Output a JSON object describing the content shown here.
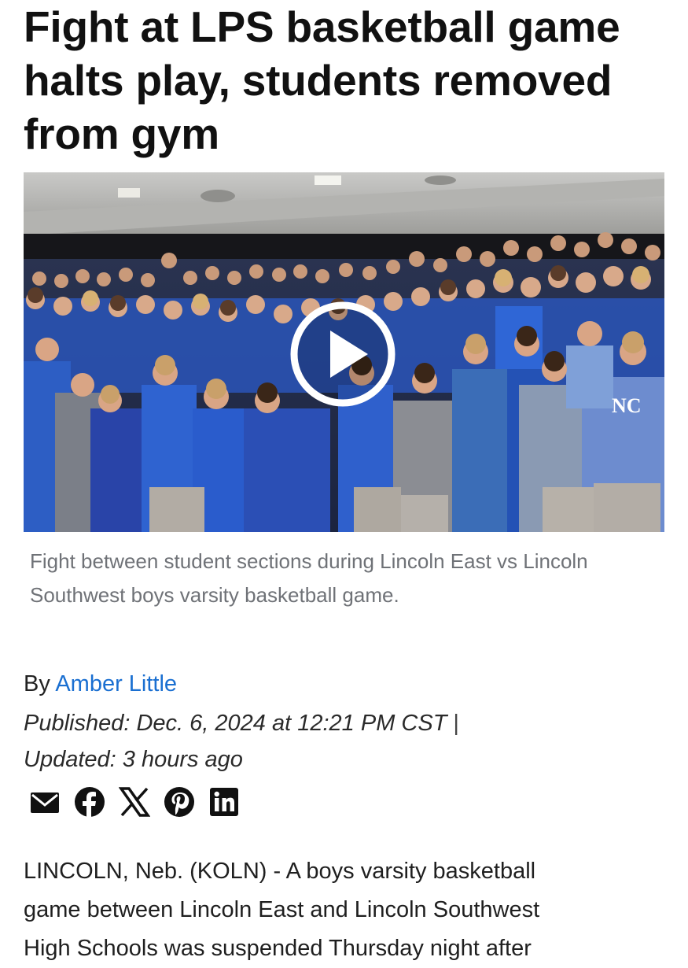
{
  "article": {
    "headline": "Fight at LPS basketball game halts play, students removed from gym",
    "caption": "Fight between student sections during Lincoln East vs Lincoln Southwest boys varsity basketball game.",
    "byline_prefix": "By",
    "author": "Amber Little",
    "published": "Published: Dec. 6, 2024 at 12:21 PM CST",
    "separator": "|",
    "updated": "Updated: 3 hours ago",
    "body_lines": [
      "LINCOLN, Neb. (KOLN) - A boys varsity basketball",
      "game between Lincoln East and Lincoln Southwest",
      "High Schools was suspended Thursday night after"
    ]
  },
  "video": {
    "play_icon": "play-icon",
    "shirt_logo": "NC"
  },
  "share": {
    "icons": [
      "email-icon",
      "facebook-icon",
      "x-icon",
      "pinterest-icon",
      "linkedin-icon"
    ]
  },
  "colors": {
    "link": "#1a6fd1",
    "caption": "#6f7277",
    "headline": "#111111"
  }
}
